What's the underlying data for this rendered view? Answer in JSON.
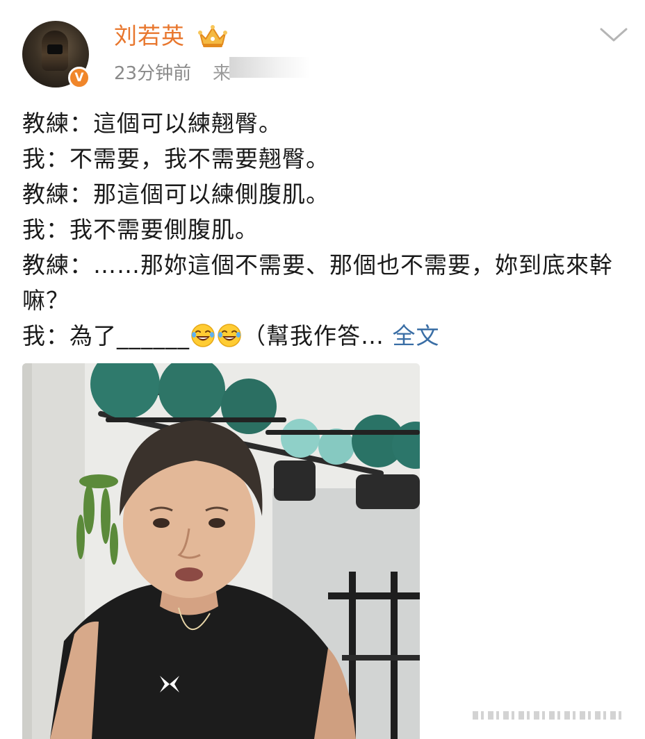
{
  "post": {
    "author": {
      "name": "刘若英",
      "verified_badge": "V",
      "badge_icon": "crown-icon",
      "avatar_icon": "avatar-photo"
    },
    "timestamp": "23分钟前",
    "source_fragment": "来",
    "menu_icon": "chevron-down-icon",
    "lines": [
      "教練：這個可以練翹臀。",
      "我：不需要，我不需要翹臀。",
      "教練：那這個可以練側腹肌。",
      "我：我不需要側腹肌。",
      "教練：……那妳這個不需要、那個也不需要，妳到底來幹嘛？"
    ],
    "last_line": {
      "prefix": "我：為了______",
      "emoji_icon": "laughing-tears-emoji",
      "suffix": "（幫我作答…",
      "full_text_link": "全文"
    },
    "photo_icon": "post-photo"
  },
  "colors": {
    "username": "#e8772e",
    "verified": "#f0862a",
    "link": "#3a6ea5",
    "muted": "#8a8a8a",
    "body_text": "#1a1a1a"
  }
}
